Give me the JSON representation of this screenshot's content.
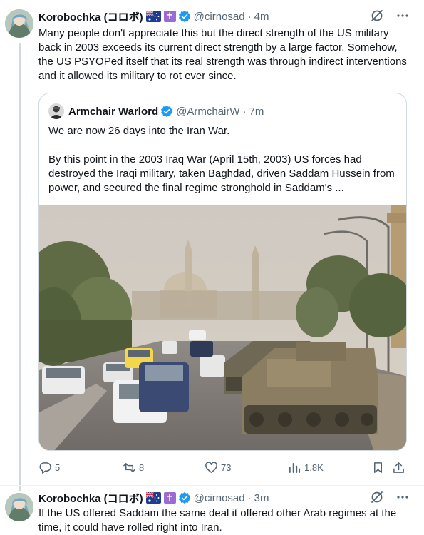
{
  "tweet1": {
    "author_name": "Korobochka (コロボ)",
    "flag_icon": "australia-flag-icon",
    "cross_badge": "✝",
    "handle": "@cirnosad",
    "separator": "·",
    "time": "4m",
    "text": "Many people don't appreciate this but the direct strength of the US military back in 2003 exceeds its current direct strength by a large factor. Somehow, the US PSYOPed itself that its real strength was through indirect interventions and it allowed its military to rot ever since.",
    "quote": {
      "author_name": "Armchair Warlord",
      "handle": "@ArmchairW",
      "separator": "·",
      "time": "7m",
      "text_line1": "We are now 26 days into the Iran War.",
      "text_line2": "By this point in the 2003 Iraq War (April 15th, 2003) US forces had destroyed the Iraqi military, taken Baghdad, driven Saddam Hussein from power, and secured the final regime stronghold in Saddam's ..."
    },
    "actions": {
      "replies": "5",
      "retweets": "8",
      "likes": "73",
      "views": "1.8K"
    }
  },
  "tweet2": {
    "author_name": "Korobochka (コロボ)",
    "flag_icon": "australia-flag-icon",
    "cross_badge": "✝",
    "handle": "@cirnosad",
    "separator": "·",
    "time": "3m",
    "text": "If the US offered Saddam the same deal it offered other Arab regimes at the time, it could have rolled right into Iran."
  },
  "colors": {
    "verified": "#1d9bf0",
    "secondary_text": "#536471",
    "border": "#cfd9de",
    "cross_badge_bg": "#9b6bd3"
  }
}
